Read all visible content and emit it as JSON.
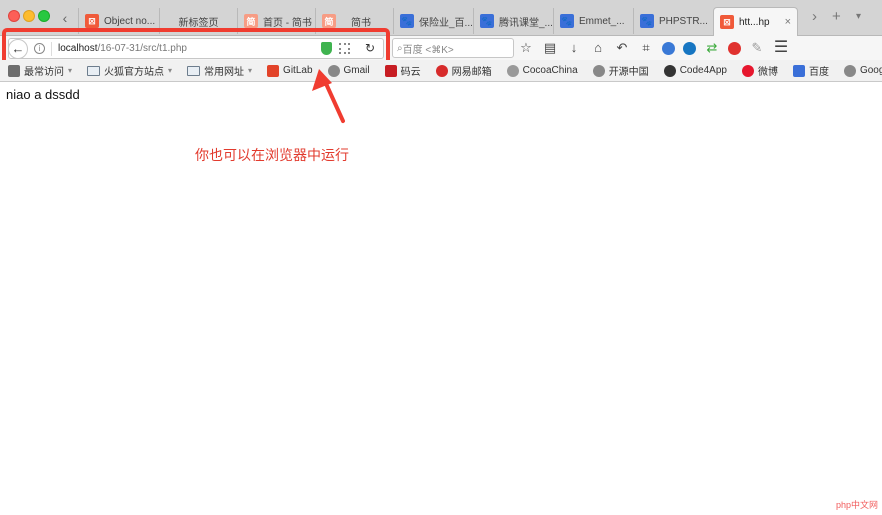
{
  "browser": {
    "tabs": [
      {
        "title": "Object no...",
        "favicon": "xampp-icon"
      },
      {
        "title": "新标签页",
        "favicon": "blank-icon"
      },
      {
        "title": "首页 - 简书",
        "favicon": "jianshu-icon"
      },
      {
        "title": "简书",
        "favicon": "jianshu-icon"
      },
      {
        "title": "保险业_百...",
        "favicon": "baidu-icon"
      },
      {
        "title": "腾讯课堂_...",
        "favicon": "baidu-icon"
      },
      {
        "title": "Emmet_...",
        "favicon": "baidu-icon"
      },
      {
        "title": "PHPSTR...",
        "favicon": "baidu-icon"
      },
      {
        "title": "htt...hp",
        "favicon": "xampp-icon",
        "active": true
      }
    ],
    "url": {
      "host": "localhost",
      "path": "/16-07-31/src/t1.php"
    },
    "search_placeholder": "百度 <⌘K>"
  },
  "bookmarks": [
    "最常访问",
    "火狐官方站点",
    "常用网址",
    "GitLab",
    "Gmail",
    "码云",
    "网易邮箱",
    "CocoaChina",
    "开源中国",
    "Code4App",
    "微博",
    "百度",
    "Google"
  ],
  "page": {
    "text": "niao a dssdd"
  },
  "annotation": {
    "text": "你也可以在浏览器中运行"
  },
  "watermark": {
    "text": "php中文网"
  },
  "colors": {
    "highlight": "#f03c30",
    "annotation": "#e23b2e",
    "traffic_close": "#fc5f57",
    "traffic_min": "#fdbc2e",
    "traffic_max": "#28c840"
  }
}
